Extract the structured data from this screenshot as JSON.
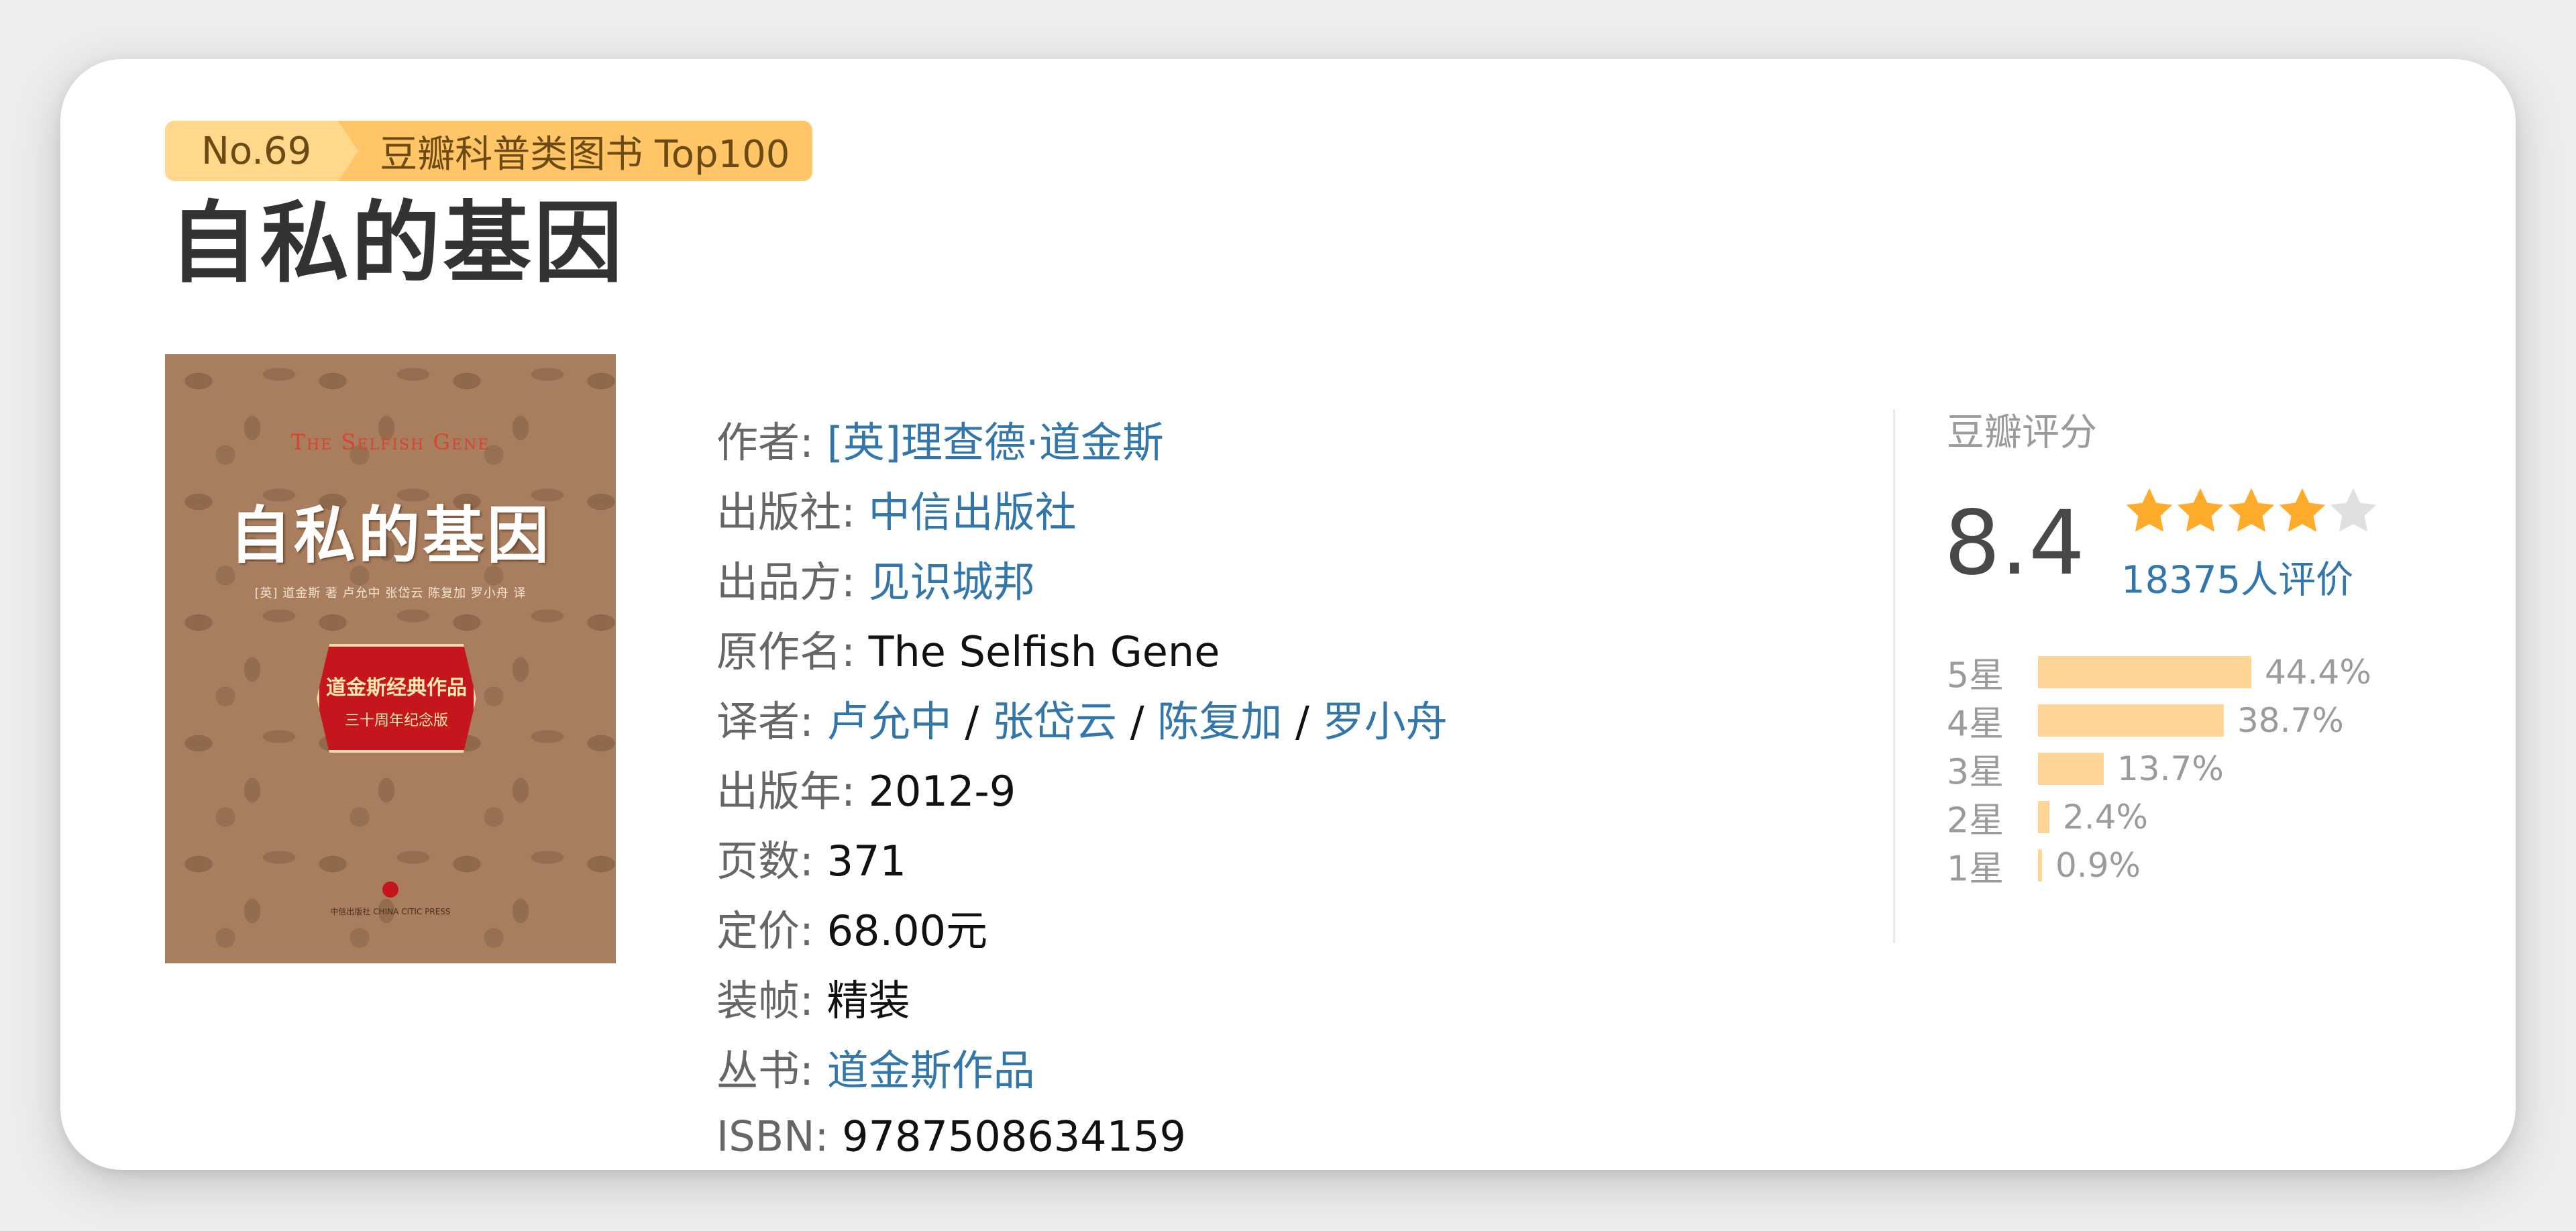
{
  "ranking": {
    "number": "No.69",
    "list": "豆瓣科普类图书 Top100"
  },
  "book": {
    "title": "自私的基因"
  },
  "cover": {
    "en_title": "The Selfish Gene",
    "cn_title": "自私的基因",
    "authors_line": "[英] 道金斯 著    卢允中  张岱云  陈复加  罗小舟 译",
    "seal_line1": "道金斯经典作品",
    "seal_line2": "三十周年纪念版",
    "publisher": "中信出版社 CHINA CITIC PRESS"
  },
  "info": {
    "author": {
      "label": "作者:",
      "value": "[英]理查德·道金斯"
    },
    "publisher": {
      "label": "出版社:",
      "value": "中信出版社"
    },
    "producer": {
      "label": "出品方:",
      "value": "见识城邦"
    },
    "original_title": {
      "label": "原作名:",
      "value": "The Selfish Gene"
    },
    "translators": {
      "label": "译者:",
      "names": [
        "卢允中",
        "张岱云",
        "陈复加",
        "罗小舟"
      ],
      "separator": "/"
    },
    "pub_year": {
      "label": "出版年:",
      "value": "2012-9"
    },
    "pages": {
      "label": "页数:",
      "value": "371"
    },
    "price": {
      "label": "定价:",
      "value": "68.00元"
    },
    "binding": {
      "label": "装帧:",
      "value": "精装"
    },
    "series": {
      "label": "丛书:",
      "value": "道金斯作品"
    },
    "isbn": {
      "label": "ISBN:",
      "value": "9787508634159"
    }
  },
  "rating": {
    "caption": "豆瓣评分",
    "score": "8.4",
    "stars_filled": 4,
    "stars_total": 5,
    "count": "18375人评价",
    "star_color": "#ffac2d",
    "star_empty_color": "#e0e0e0",
    "bar_color": "#ffd596",
    "distribution": [
      {
        "label": "5星",
        "percent": 44.4,
        "display": "44.4%"
      },
      {
        "label": "4星",
        "percent": 38.7,
        "display": "38.7%"
      },
      {
        "label": "3星",
        "percent": 13.7,
        "display": "13.7%"
      },
      {
        "label": "2星",
        "percent": 2.4,
        "display": "2.4%"
      },
      {
        "label": "1星",
        "percent": 0.9,
        "display": "0.9%"
      }
    ]
  },
  "colors": {
    "link": "#3377aa",
    "badge_light": "#ffd88c",
    "badge_dark": "#ffc566"
  }
}
